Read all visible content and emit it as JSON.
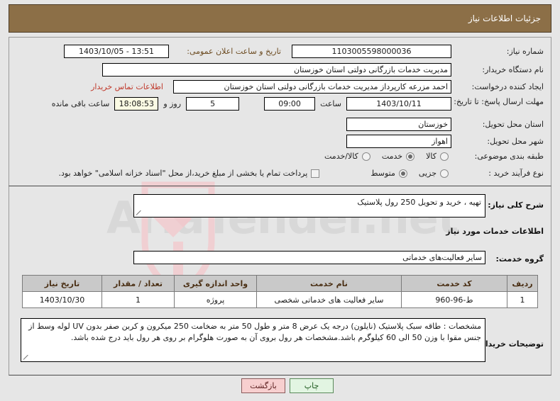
{
  "header": {
    "title": "جزئیات اطلاعات نیاز"
  },
  "form": {
    "need_number_label": "شماره نیاز:",
    "need_number_value": "1103005598000036",
    "announce_label": "تاریخ و ساعت اعلان عمومی:",
    "announce_value": "13:51 - 1403/10/05",
    "buyer_org_label": "نام دستگاه خریدار:",
    "buyer_org_value": "مدیریت خدمات بازرگانی دولتی استان خوزستان",
    "creator_label": "ایجاد کننده درخواست:",
    "creator_value": "احمد مزرعه کارپرداز مدیریت خدمات بازرگانی دولتی استان خوزستان",
    "contact_link": "اطلاعات تماس خریدار",
    "deadline_label": "مهلت ارسال پاسخ: تا تاریخ:",
    "deadline_date": "1403/10/11",
    "hour_label": "ساعت",
    "deadline_time": "09:00",
    "days_value": "5",
    "days_label": "روز و",
    "countdown_value": "18:08:53",
    "countdown_label": "ساعت باقی مانده",
    "province_label": "استان محل تحویل:",
    "province_value": "خوزستان",
    "city_label": "شهر محل تحویل:",
    "city_value": "اهواز",
    "category_label": "طبقه بندی موضوعی:",
    "category_options": [
      "کالا",
      "خدمت",
      "کالا/خدمت"
    ],
    "category_selected": "خدمت",
    "process_label": "نوع فرآیند خرید :",
    "process_options": [
      "جزیی",
      "متوسط"
    ],
    "process_selected": "متوسط",
    "treasury_checkbox_label": "پرداخت تمام یا بخشی از مبلغ خرید،از محل \"اسناد خزانه اسلامی\" خواهد بود.",
    "treasury_checked": false
  },
  "details": {
    "general_desc_label": "شرح کلی نیاز:",
    "general_desc_value": "تهیه ، خرید و تحویل 250 رول پلاستیک",
    "services_section_title": "اطلاعات خدمات مورد نیاز",
    "service_group_label": "گروه خدمت:",
    "service_group_value": "سایر فعالیت‌های خدماتی"
  },
  "table": {
    "headers": [
      "ردیف",
      "کد خدمت",
      "نام خدمت",
      "واحد اندازه گیری",
      "تعداد / مقدار",
      "تاریخ نیاز"
    ],
    "rows": [
      {
        "row_no": "1",
        "service_code": "ط-96-960",
        "service_name": "سایر فعالیت های خدماتی شخصی",
        "unit": "پروژه",
        "quantity": "1",
        "need_date": "1403/10/30"
      }
    ]
  },
  "notes": {
    "label": "توضیحات خریدار:",
    "value": "مشخصات : طاقه سبک پلاستیک (نایلون) درجه یک عرض 8 متر و طول 50 متر به ضخامت 250 میکرون و کربن صفر بدون UV لوله وسط از جنس مقوا با وزن 50 الی 60 کیلوگرم باشد.مشخصات هر رول بروی آن به صورت هلوگرام بر روی هر رول باید درج شده باشد."
  },
  "buttons": {
    "back": "بازگشت",
    "print": "چاپ"
  },
  "watermark": {
    "text": "AriaTender.net"
  },
  "colors": {
    "header_bg": "#8c6f47",
    "table_header_bg": "#c9c9c9",
    "link_red": "#c0392b",
    "back_btn_bg": "#f7cfcf",
    "print_btn_bg": "#e2f5e2",
    "countdown_bg": "#fbfbe4"
  }
}
